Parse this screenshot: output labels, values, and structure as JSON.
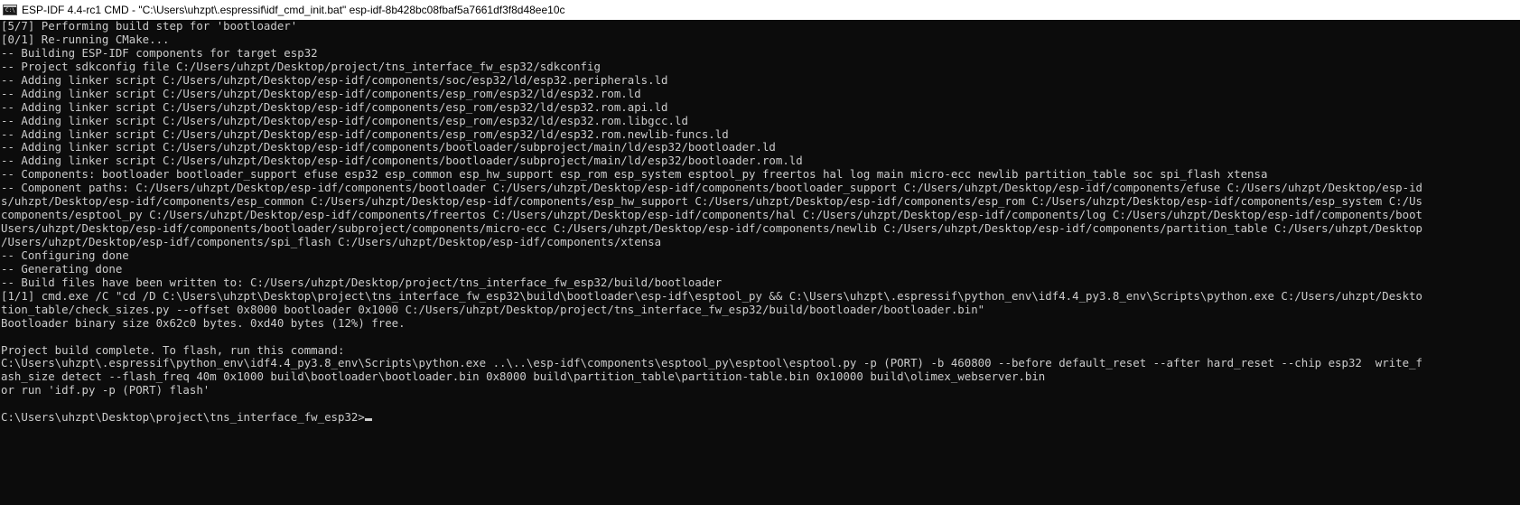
{
  "window": {
    "title": "ESP-IDF 4.4-rc1 CMD - \"C:\\Users\\uhzpt\\.espressif\\idf_cmd_init.bat\"  esp-idf-8b428bc08fbaf5a7661df3f8d48ee10c",
    "icon": "cmd-console-icon",
    "icon_text": "C:\\",
    "background_color": "#0c0c0c",
    "text_color": "#cccccc"
  },
  "console": {
    "lines": [
      "[5/7] Performing build step for 'bootloader'",
      "[0/1] Re-running CMake...",
      "-- Building ESP-IDF components for target esp32",
      "-- Project sdkconfig file C:/Users/uhzpt/Desktop/project/tns_interface_fw_esp32/sdkconfig",
      "-- Adding linker script C:/Users/uhzpt/Desktop/esp-idf/components/soc/esp32/ld/esp32.peripherals.ld",
      "-- Adding linker script C:/Users/uhzpt/Desktop/esp-idf/components/esp_rom/esp32/ld/esp32.rom.ld",
      "-- Adding linker script C:/Users/uhzpt/Desktop/esp-idf/components/esp_rom/esp32/ld/esp32.rom.api.ld",
      "-- Adding linker script C:/Users/uhzpt/Desktop/esp-idf/components/esp_rom/esp32/ld/esp32.rom.libgcc.ld",
      "-- Adding linker script C:/Users/uhzpt/Desktop/esp-idf/components/esp_rom/esp32/ld/esp32.rom.newlib-funcs.ld",
      "-- Adding linker script C:/Users/uhzpt/Desktop/esp-idf/components/bootloader/subproject/main/ld/esp32/bootloader.ld",
      "-- Adding linker script C:/Users/uhzpt/Desktop/esp-idf/components/bootloader/subproject/main/ld/esp32/bootloader.rom.ld",
      "-- Components: bootloader bootloader_support efuse esp32 esp_common esp_hw_support esp_rom esp_system esptool_py freertos hal log main micro-ecc newlib partition_table soc spi_flash xtensa",
      "-- Component paths: C:/Users/uhzpt/Desktop/esp-idf/components/bootloader C:/Users/uhzpt/Desktop/esp-idf/components/bootloader_support C:/Users/uhzpt/Desktop/esp-idf/components/efuse C:/Users/uhzpt/Desktop/esp-id",
      "s/uhzpt/Desktop/esp-idf/components/esp_common C:/Users/uhzpt/Desktop/esp-idf/components/esp_hw_support C:/Users/uhzpt/Desktop/esp-idf/components/esp_rom C:/Users/uhzpt/Desktop/esp-idf/components/esp_system C:/Us",
      "components/esptool_py C:/Users/uhzpt/Desktop/esp-idf/components/freertos C:/Users/uhzpt/Desktop/esp-idf/components/hal C:/Users/uhzpt/Desktop/esp-idf/components/log C:/Users/uhzpt/Desktop/esp-idf/components/boot",
      "Users/uhzpt/Desktop/esp-idf/components/bootloader/subproject/components/micro-ecc C:/Users/uhzpt/Desktop/esp-idf/components/newlib C:/Users/uhzpt/Desktop/esp-idf/components/partition_table C:/Users/uhzpt/Desktop",
      "/Users/uhzpt/Desktop/esp-idf/components/spi_flash C:/Users/uhzpt/Desktop/esp-idf/components/xtensa",
      "-- Configuring done",
      "-- Generating done",
      "-- Build files have been written to: C:/Users/uhzpt/Desktop/project/tns_interface_fw_esp32/build/bootloader",
      "[1/1] cmd.exe /C \"cd /D C:\\Users\\uhzpt\\Desktop\\project\\tns_interface_fw_esp32\\build\\bootloader\\esp-idf\\esptool_py && C:\\Users\\uhzpt\\.espressif\\python_env\\idf4.4_py3.8_env\\Scripts\\python.exe C:/Users/uhzpt/Deskto",
      "tion_table/check_sizes.py --offset 0x8000 bootloader 0x1000 C:/Users/uhzpt/Desktop/project/tns_interface_fw_esp32/build/bootloader/bootloader.bin\"",
      "Bootloader binary size 0x62c0 bytes. 0xd40 bytes (12%) free.",
      "",
      "Project build complete. To flash, run this command:",
      "C:\\Users\\uhzpt\\.espressif\\python_env\\idf4.4_py3.8_env\\Scripts\\python.exe ..\\..\\esp-idf\\components\\esptool_py\\esptool\\esptool.py -p (PORT) -b 460800 --before default_reset --after hard_reset --chip esp32  write_f",
      "ash_size detect --flash_freq 40m 0x1000 build\\bootloader\\bootloader.bin 0x8000 build\\partition_table\\partition-table.bin 0x10000 build\\olimex_webserver.bin",
      "or run 'idf.py -p (PORT) flash'",
      ""
    ],
    "prompt": "C:\\Users\\uhzpt\\Desktop\\project\\tns_interface_fw_esp32>",
    "command_input": ""
  }
}
